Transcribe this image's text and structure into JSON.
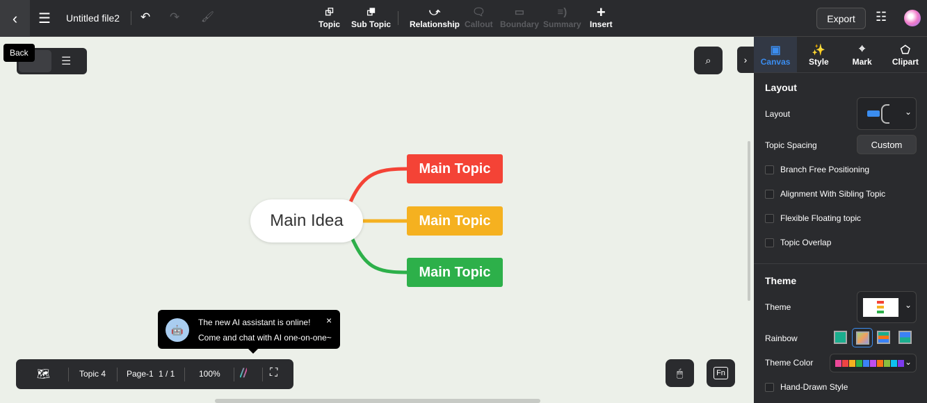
{
  "header": {
    "back_tooltip": "Back",
    "file_title": "Untitled file2",
    "export_label": "Export",
    "tools": [
      {
        "label": "Topic",
        "icon": "topic-icon",
        "enabled": true
      },
      {
        "label": "Sub Topic",
        "icon": "subtopic-icon",
        "enabled": true
      },
      {
        "label": "Relationship",
        "icon": "relationship-icon",
        "enabled": true
      },
      {
        "label": "Callout",
        "icon": "callout-icon",
        "enabled": false
      },
      {
        "label": "Boundary",
        "icon": "boundary-icon",
        "enabled": false
      },
      {
        "label": "Summary",
        "icon": "summary-icon",
        "enabled": false
      },
      {
        "label": "Insert",
        "icon": "plus-icon",
        "enabled": true
      }
    ]
  },
  "canvas": {
    "main_idea": "Main Idea",
    "topics": [
      {
        "label": "Main Topic",
        "color": "#f44336"
      },
      {
        "label": "Main Topic",
        "color": "#f5b120"
      },
      {
        "label": "Main Topic",
        "color": "#2db04a"
      }
    ],
    "background": "#ecf0e9"
  },
  "ai_popup": {
    "line1": "The new AI assistant is online!",
    "line2": "Come and chat with AI one-on-one~",
    "close": "×"
  },
  "bottom_bar": {
    "topic_count": "Topic 4",
    "page": "Page-1",
    "page_index": "1 / 1",
    "zoom": "100%"
  },
  "panel": {
    "tabs": [
      {
        "label": "Canvas",
        "active": true
      },
      {
        "label": "Style"
      },
      {
        "label": "Mark"
      },
      {
        "label": "Clipart"
      }
    ],
    "layout_section": "Layout",
    "layout_label": "Layout",
    "topic_spacing_label": "Topic Spacing",
    "topic_spacing_value": "Custom",
    "checkboxes": [
      "Branch Free Positioning",
      "Alignment With Sibling Topic",
      "Flexible Floating topic",
      "Topic Overlap"
    ],
    "theme_section": "Theme",
    "theme_label": "Theme",
    "rainbow_label": "Rainbow",
    "theme_color_label": "Theme Color",
    "hand_drawn": "Hand-Drawn Style",
    "theme_colors": [
      "#ec4899",
      "#ef4444",
      "#f5b120",
      "#2db04a",
      "#3b82f6",
      "#c04ef0",
      "#f97316",
      "#8bbf3f",
      "#0ec2f0",
      "#7c3aed"
    ],
    "accent": "#3b8df0"
  }
}
